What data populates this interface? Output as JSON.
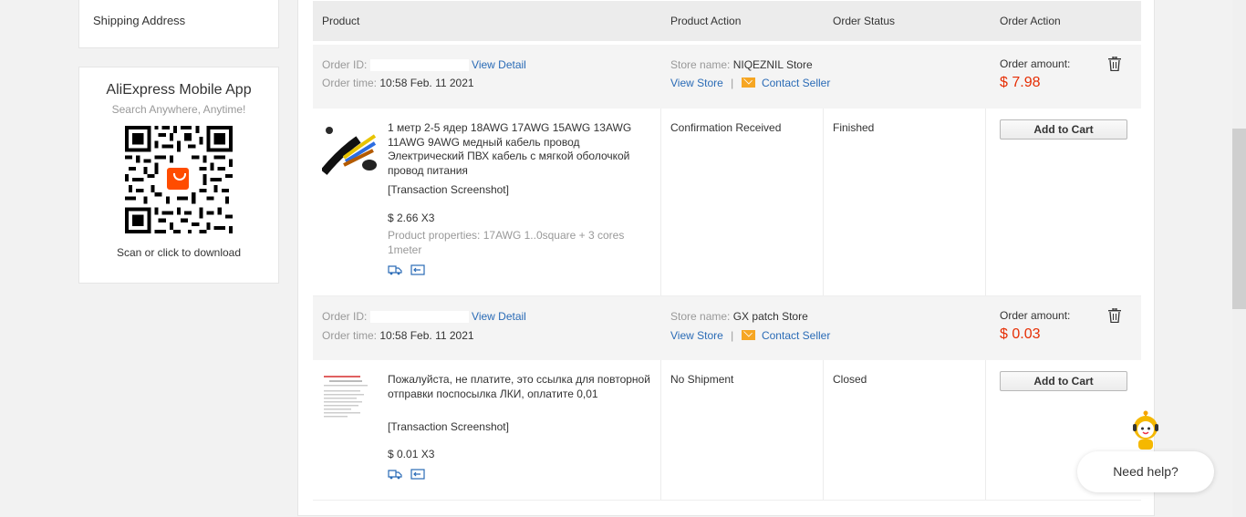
{
  "sidebar": {
    "shipping_link": "Shipping Address",
    "app": {
      "title": "AliExpress Mobile App",
      "subtitle": "Search Anywhere, Anytime!",
      "scan": "Scan or click to download",
      "qr_icon": "aliexpress-logo-icon"
    }
  },
  "table": {
    "headers": [
      "Product",
      "Product Action",
      "Order Status",
      "Order Action"
    ]
  },
  "labels": {
    "order_id": "Order ID:",
    "order_time": "Order time:",
    "view_detail": "View Detail",
    "store_name": "Store name:",
    "view_store": "View Store",
    "separator": "|",
    "contact_seller": "Contact Seller",
    "order_amount": "Order amount:",
    "add_to_cart": "Add to Cart",
    "transaction_screenshot": "[Transaction Screenshot]"
  },
  "orders": [
    {
      "time": "10:58 Feb. 11 2021",
      "store": "NIQEZNIL Store",
      "amount": "$ 7.98",
      "product_title": "1 метр 2-5 ядер 18AWG 17AWG 15AWG 13AWG 11AWG 9AWG медный кабель провод Электрический ПВХ кабель с мягкой оболочкой провод питания",
      "price_qty": "$ 2.66 X3",
      "properties": "Product properties: 17AWG 1..0square + 3 cores 1meter",
      "product_action": "Confirmation Received",
      "status": "Finished"
    },
    {
      "time": "10:58 Feb. 11 2021",
      "store": "GX patch Store",
      "amount": "$ 0.03",
      "product_title": "Пожалуйста, не платите, это ссылка для повторной отправки поспосылка ЛКИ, оплатите 0,01",
      "price_qty": "$ 0.01 X3",
      "product_action": "No Shipment",
      "status": "Closed"
    }
  ],
  "help": {
    "label": "Need help?",
    "icon": "robot-assistant-icon"
  },
  "colors": {
    "accent_link": "#2a6bb6",
    "amount_red": "#e62e04",
    "envelope": "#f6a623"
  }
}
